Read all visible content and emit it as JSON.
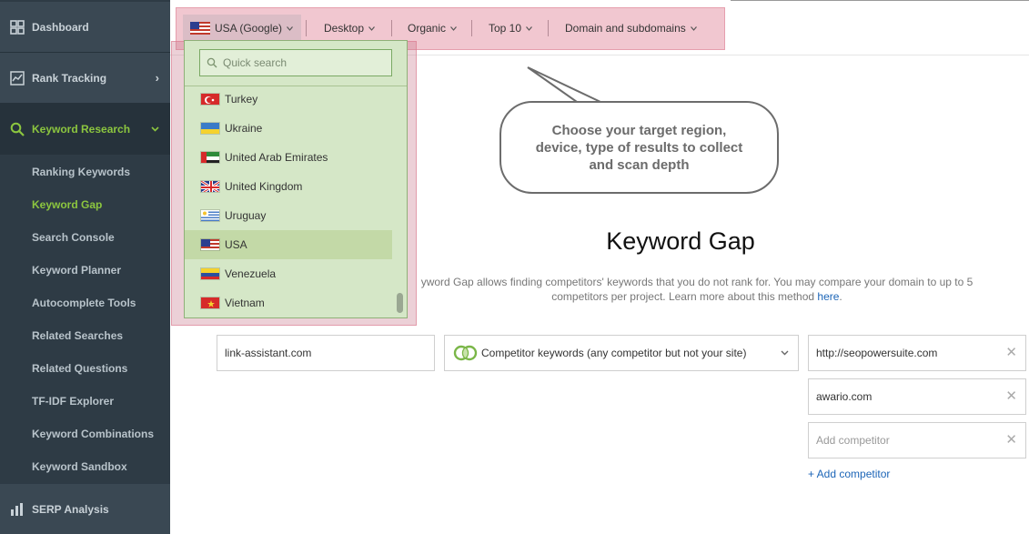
{
  "sidebar": {
    "top_items": [
      {
        "label": "Dashboard",
        "icon": "dashboard-grid-icon"
      },
      {
        "label": "Rank Tracking",
        "icon": "chart-line-icon"
      },
      {
        "label": "Keyword Research",
        "icon": "search-icon"
      }
    ],
    "sub_items": [
      {
        "label": "Ranking Keywords"
      },
      {
        "label": "Keyword Gap",
        "active": true
      },
      {
        "label": "Search Console"
      },
      {
        "label": "Keyword Planner"
      },
      {
        "label": "Autocomplete Tools"
      },
      {
        "label": "Related Searches"
      },
      {
        "label": "Related Questions"
      },
      {
        "label": "TF-IDF Explorer"
      },
      {
        "label": "Keyword Combinations"
      },
      {
        "label": "Keyword Sandbox"
      }
    ],
    "bottom_item": {
      "label": "SERP Analysis",
      "icon": "bar-chart-icon"
    }
  },
  "toolbar": {
    "region": "USA (Google)",
    "device": "Desktop",
    "results_type": "Organic",
    "depth": "Top 10",
    "scope": "Domain and subdomains"
  },
  "dropdown": {
    "search_placeholder": "Quick search",
    "items": [
      {
        "name": "Turkey",
        "flag": "turkey-flag-icon"
      },
      {
        "name": "Ukraine",
        "flag": "ukraine-flag-icon"
      },
      {
        "name": "United Arab Emirates",
        "flag": "uae-flag-icon"
      },
      {
        "name": "United Kingdom",
        "flag": "uk-flag-icon"
      },
      {
        "name": "Uruguay",
        "flag": "uruguay-flag-icon"
      },
      {
        "name": "USA",
        "flag": "usa-flag-icon",
        "selected": true
      },
      {
        "name": "Venezuela",
        "flag": "venezuela-flag-icon"
      },
      {
        "name": "Vietnam",
        "flag": "vietnam-flag-icon"
      }
    ]
  },
  "callout": {
    "line1": "Choose your target region,",
    "line2": "device, type of results to collect",
    "line3": "and scan depth"
  },
  "main": {
    "title": "Keyword Gap",
    "description_part1": "yword Gap allows finding competitors' keywords that you do not rank for. You may compare your domain to up to 5",
    "description_part2": "competitors per project. Learn more about this method ",
    "description_link": "here",
    "description_end": "."
  },
  "form": {
    "domain_value": "link-assistant.com",
    "mode_value": "Competitor keywords (any competitor but not your site)",
    "competitor1": "http://seopowersuite.com",
    "competitor2": "awario.com",
    "competitor_placeholder": "Add competitor",
    "add_competitor_label": "+ Add competitor"
  },
  "colors": {
    "accent_green": "#8cc63f",
    "sidebar_bg": "#2e3b45",
    "link_blue": "#1c65b7",
    "dropdown_bg": "#d5e7c7"
  }
}
